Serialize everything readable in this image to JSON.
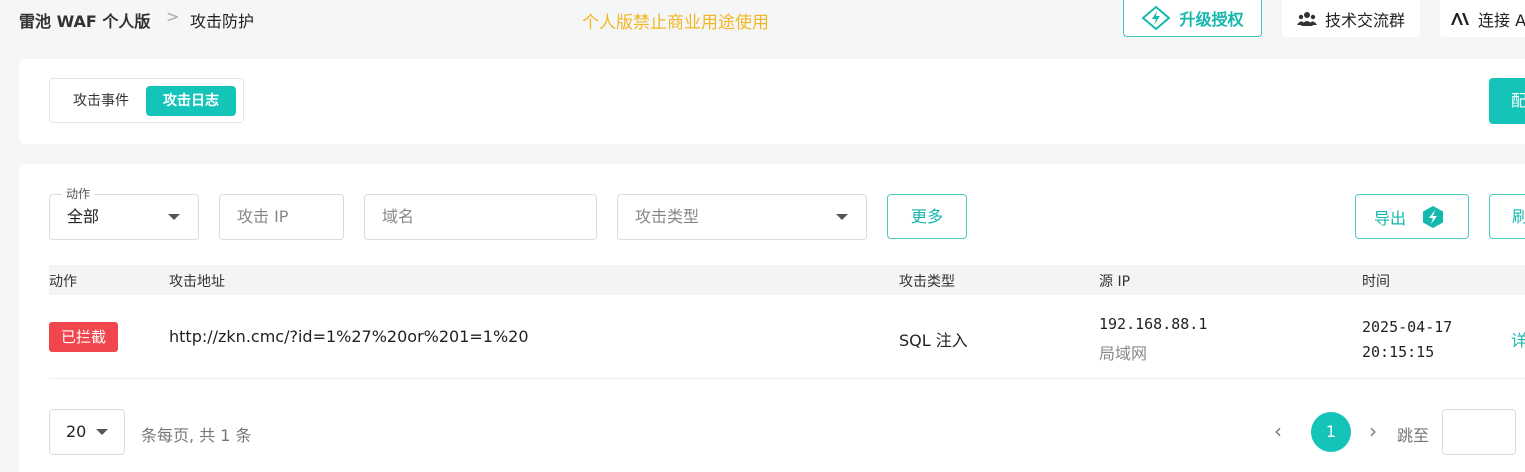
{
  "header": {
    "breadcrumb_root": "雷池 WAF 个人版",
    "breadcrumb_sep": ">",
    "breadcrumb_current": "攻击防护",
    "warning": "个人版禁止商业用途使用",
    "upgrade_label": "升级授权",
    "group_label": "技术交流群",
    "ai_label": "连接 A",
    "accent_color": "#14c4b8",
    "warning_color": "#f2b823"
  },
  "tabs": {
    "events_label": "攻击事件",
    "logs_label": "攻击日志",
    "config_label": "配"
  },
  "filters": {
    "action_label": "动作",
    "action_value": "全部",
    "ip_placeholder": "攻击 IP",
    "domain_placeholder": "域名",
    "type_placeholder": "攻击类型",
    "more_label": "更多",
    "export_label": "导出",
    "refresh_label": "刷"
  },
  "table": {
    "headers": {
      "action": "动作",
      "url": "攻击地址",
      "type": "攻击类型",
      "src_ip": "源 IP",
      "time": "时间"
    },
    "rows": [
      {
        "action": "已拦截",
        "url": "http://zkn.cmc/?id=1%27%20or%201=1%20",
        "type": "SQL 注入",
        "ip": "192.168.88.1",
        "location": "局域网",
        "time": "2025-04-17 20:15:15",
        "detail": "详"
      }
    ]
  },
  "pagination": {
    "page_size": "20",
    "summary": "条每页, 共 1 条",
    "prev": "‹",
    "current_page": "1",
    "next": "›",
    "jump_label": "跳至"
  }
}
